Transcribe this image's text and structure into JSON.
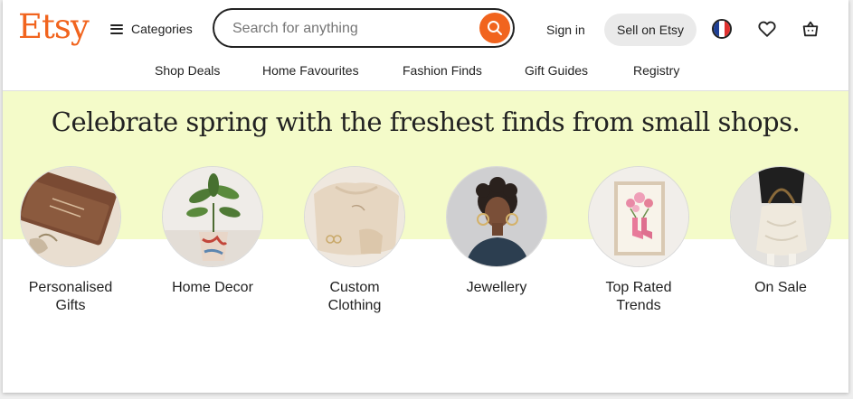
{
  "header": {
    "logo": "Etsy",
    "categories_label": "Categories",
    "search_placeholder": "Search for anything",
    "signin_label": "Sign in",
    "sell_label": "Sell on Etsy"
  },
  "subnav": [
    "Shop Deals",
    "Home Favourites",
    "Fashion Finds",
    "Gift Guides",
    "Registry"
  ],
  "hero": {
    "headline": "Celebrate spring with the freshest finds from small shops."
  },
  "categories": [
    {
      "line1": "Personalised",
      "line2": "Gifts"
    },
    {
      "line1": "Home Decor",
      "line2": ""
    },
    {
      "line1": "Custom",
      "line2": "Clothing"
    },
    {
      "line1": "Jewellery",
      "line2": ""
    },
    {
      "line1": "Top Rated",
      "line2": "Trends"
    },
    {
      "line1": "On Sale",
      "line2": ""
    }
  ],
  "colors": {
    "brand": "#f1641e",
    "hero_bg": "#f4fbc9",
    "sell_bg": "#eaeaea"
  }
}
